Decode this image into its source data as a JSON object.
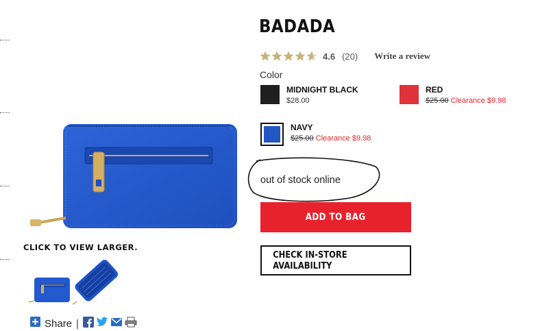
{
  "product": {
    "title": "BADADA",
    "rating": "4.6",
    "review_count": "(20)",
    "write_review": "Write a review",
    "stars": 4.6,
    "color_label": "Color"
  },
  "colors": [
    {
      "name": "MIDNIGHT BLACK",
      "price": "$28.00",
      "swatch": "#1f1f1f"
    },
    {
      "name": "RED",
      "price_original": "$25.00",
      "clearance": "Clearance $9.98",
      "swatch": "#e0323a"
    },
    {
      "name": "NAVY",
      "price_original": "$25.00",
      "clearance": "Clearance $9.98",
      "swatch": "#2257c4",
      "selected": true
    }
  ],
  "stock_note": "out of stock online",
  "buttons": {
    "add_to_bag": "ADD TO BAG",
    "check_store": "CHECK IN-STORE AVAILABILITY"
  },
  "gallery": {
    "click_label": "CLICK TO VIEW LARGER.",
    "main_image": "blue-zip-wallet",
    "thumbnails": [
      "wallet-front-thumbnail",
      "wallet-open-thumbnail"
    ]
  },
  "share": {
    "label": "Share",
    "icons": [
      "plus-icon",
      "facebook-icon",
      "twitter-icon",
      "email-icon",
      "print-icon"
    ]
  },
  "theme": {
    "accent_red": "#e8222c",
    "star_gold": "#c8b27a",
    "clearance_red": "#e8222c"
  }
}
